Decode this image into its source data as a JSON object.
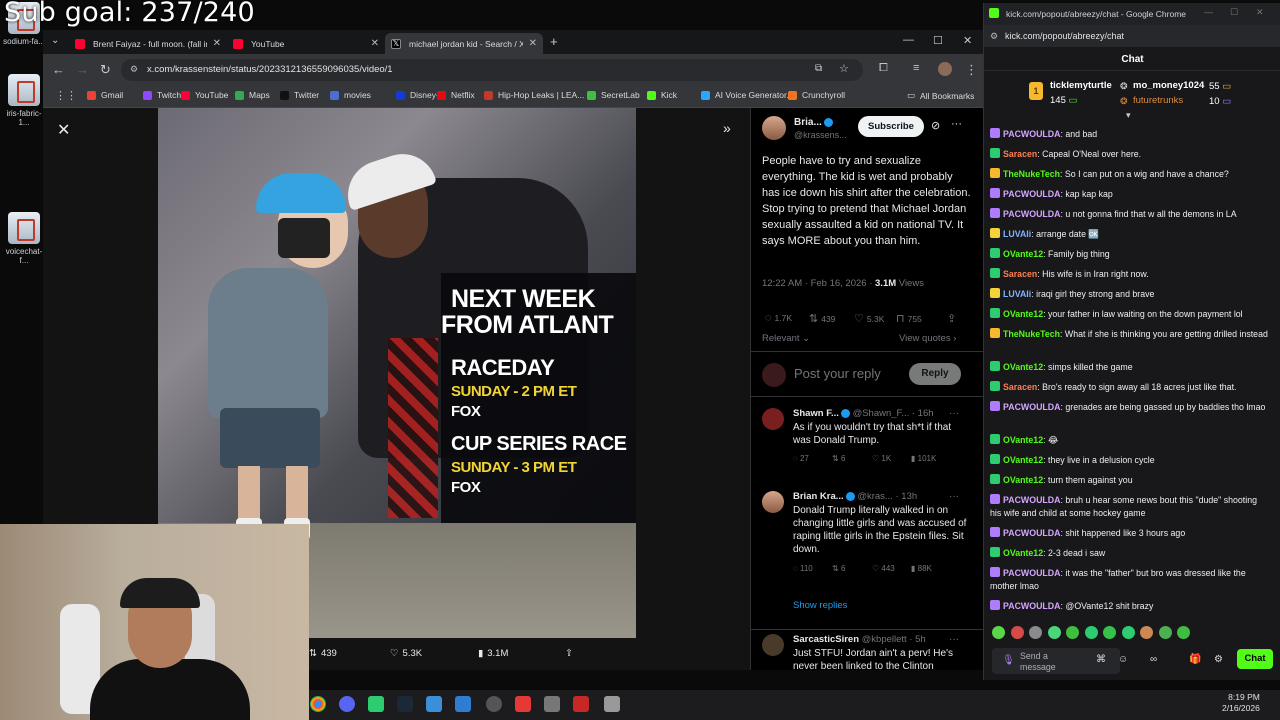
{
  "overlay": {
    "sub_goal": "Sub goal: 237/240"
  },
  "desktop_icons": [
    {
      "label": "sodium-fa..."
    },
    {
      "label": "iris-fabric-1..."
    },
    {
      "label": "voicechat-f..."
    }
  ],
  "browser": {
    "tabs": [
      {
        "label": "Brent Faiyaz - full moon. (fall in",
        "icon": "youtube-icon"
      },
      {
        "label": "YouTube",
        "icon": "youtube-icon"
      },
      {
        "label": "michael jordan kid - Search / X",
        "icon": "x-icon",
        "active": true
      }
    ],
    "url": "x.com/krassenstein/status/2023312136559096035/video/1",
    "bookmarks": [
      {
        "label": "Gmail",
        "color": "#ea4335"
      },
      {
        "label": "Twitch",
        "color": "#9146ff"
      },
      {
        "label": "YouTube",
        "color": "#ff0033"
      },
      {
        "label": "Maps",
        "color": "#34a853"
      },
      {
        "label": "Twitter",
        "color": "#111111"
      },
      {
        "label": "movies",
        "color": "#4a6fd1"
      },
      {
        "label": "Disney+",
        "color": "#113ccf"
      },
      {
        "label": "Netflix",
        "color": "#e50914"
      },
      {
        "label": "Hip-Hop Leaks | LEA...",
        "color": "#c0392b"
      },
      {
        "label": "SecretLab",
        "color": "#3fbf3f"
      },
      {
        "label": "Kick",
        "color": "#53fc18"
      },
      {
        "label": "AI Voice Generator...",
        "color": "#2aa7ff"
      },
      {
        "label": "Crunchyroll",
        "color": "#f47521"
      }
    ],
    "all_bookmarks": "All Bookmarks"
  },
  "video": {
    "promo_line1": "NEXT WEEK",
    "promo_line2": "FROM ATLANT",
    "raceday_label": "RACEDAY",
    "raceday_time": "SUNDAY - 2 PM ET",
    "raceday_network": "FOX",
    "cup_label": "CUP SERIES RACE",
    "cup_time": "SUNDAY - 3 PM ET",
    "cup_network": "FOX",
    "stats": {
      "reposts": "439",
      "likes": "5.3K",
      "views": "3.1M"
    }
  },
  "tweet": {
    "author": "Bria...",
    "handle": "@krassens...",
    "subscribe": "Subscribe",
    "body": "People have to try and sexualize everything.  The kid is wet and probably has ice down his  shirt after the celebration.  Stop trying to pretend that Michael Jordan sexually assaulted a kid on national TV. It says MORE about you than him.",
    "time": "12:22 AM · Feb 16, 2026 · ",
    "views_count": "3.1M",
    "views_label": " Views",
    "engagement": {
      "replies": "1.7K",
      "reposts": "439",
      "likes": "5.3K",
      "bookmarks": "755"
    },
    "relevant": "Relevant",
    "view_quotes": "View quotes",
    "reply_placeholder": "Post your reply",
    "reply_button": "Reply",
    "show_replies": "Show replies"
  },
  "replies": [
    {
      "name": "Shawn F...",
      "handle": "@Shawn_F... · 16h",
      "text": "As if you wouldn't try that sh*t if that was Donald Trump.",
      "stats": {
        "replies": "27",
        "reposts": "6",
        "likes": "1K",
        "views": "101K"
      }
    },
    {
      "name": "Brian Kra...",
      "handle": "@kras... · 13h",
      "text": "Donald Trump literally walked in on changing little girls and was accused of raping little girls in the Epstein files.  Sit down.",
      "stats": {
        "replies": "110",
        "reposts": "6",
        "likes": "443",
        "views": "88K"
      }
    },
    {
      "name": "SarcasticSiren",
      "handle": "@kbpellett · 5h",
      "text": "Just STFU! Jordan ain't a perv! He's never been linked to the Clinton",
      "stats": null
    }
  ],
  "chat_window": {
    "title": "kick.com/popout/abreezy/chat - Google Chrome",
    "url": "kick.com/popout/abreezy/chat",
    "header": "Chat",
    "leaderboard": [
      {
        "name": "ticklemyturtle",
        "value": "145"
      },
      {
        "name": "mo_money1024",
        "value": "55"
      },
      {
        "name": "futuretrunks",
        "value": "10"
      }
    ],
    "messages": [
      {
        "user": "PACWOULDA",
        "text": "and bad",
        "color": "#d4a6ff"
      },
      {
        "user": "Saracen",
        "text": "Capeal O'Neal over here.",
        "color": "#ff7f50"
      },
      {
        "user": "TheNukeTech",
        "text": "So I can put on a wig and have a chance?",
        "color": "#53fc18"
      },
      {
        "user": "PACWOULDA",
        "text": "kap kap kap",
        "color": "#d4a6ff"
      },
      {
        "user": "PACWOULDA",
        "text": "u not gonna find that w all the demons in LA",
        "color": "#d4a6ff"
      },
      {
        "user": "LUVAIi",
        "text": "arrange date 🆗",
        "color": "#7fb3ff"
      },
      {
        "user": "OVante12",
        "text": "Family big thing",
        "color": "#53fc18"
      },
      {
        "user": "Saracen",
        "text": "His wife is in Iran right now.",
        "color": "#ff7f50"
      },
      {
        "user": "LUVAIi",
        "text": "iraqi girl they strong and brave",
        "color": "#7fb3ff"
      },
      {
        "user": "OVante12",
        "text": "your father in law waiting on the down payment lol",
        "color": "#53fc18"
      },
      {
        "user": "TheNukeTech",
        "text": "What if she is thinking you are getting drilled instead",
        "color": "#53fc18"
      },
      {
        "user": "OVante12",
        "text": "simps killed the game",
        "color": "#53fc18"
      },
      {
        "user": "Saracen",
        "text": "Bro's ready to sign away all 18 acres just like that.",
        "color": "#ff7f50"
      },
      {
        "user": "PACWOULDA",
        "text": "grenades are being gassed up by baddies tho lmao",
        "color": "#d4a6ff"
      },
      {
        "user": "OVante12",
        "text": "😂",
        "color": "#53fc18"
      },
      {
        "user": "OVante12",
        "text": "they live in a delusion cycle",
        "color": "#53fc18"
      },
      {
        "user": "OVante12",
        "text": "turn them against you",
        "color": "#53fc18"
      },
      {
        "user": "PACWOULDA",
        "text": "bruh u hear some news bout this \"dude\" shooting his wife and child at some hockey game",
        "color": "#d4a6ff"
      },
      {
        "user": "PACWOULDA",
        "text": "shit happened like 3 hours ago",
        "color": "#d4a6ff"
      },
      {
        "user": "OVante12",
        "text": "2-3 dead i saw",
        "color": "#53fc18"
      },
      {
        "user": "PACWOULDA",
        "text": "it was the \"father\" but bro was dressed like the mother lmao",
        "color": "#d4a6ff"
      },
      {
        "user": "PACWOULDA",
        "text": "@OVante12 shit brazy",
        "color": "#d4a6ff"
      }
    ],
    "input_placeholder": "Send a message",
    "send_button": "Chat"
  },
  "taskbar": {
    "time": "8:19 PM",
    "date": "2/16/2026"
  }
}
